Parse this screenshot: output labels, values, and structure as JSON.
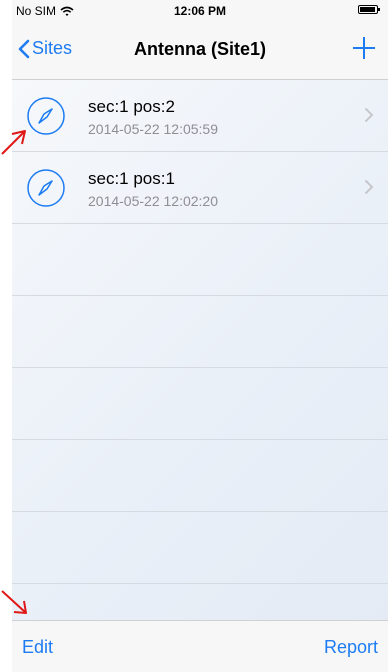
{
  "status_bar": {
    "carrier": "No SIM",
    "time": "12:06 PM"
  },
  "nav": {
    "back_label": "Sites",
    "title": "Antenna (Site1)"
  },
  "rows": [
    {
      "title": "sec:1  pos:2",
      "timestamp": "2014-05-22 12:05:59"
    },
    {
      "title": "sec:1  pos:1",
      "timestamp": "2014-05-22 12:02:20"
    }
  ],
  "toolbar": {
    "edit_label": "Edit",
    "report_label": "Report"
  },
  "colors": {
    "accent": "#1d7cf2",
    "annotation_arrow": "#e01818"
  },
  "icons": {
    "row_icon": "compass-icon",
    "add": "plus-icon",
    "back": "chevron-left-icon",
    "disclosure": "chevron-right-icon",
    "wifi": "wifi-icon",
    "battery": "battery-icon"
  }
}
